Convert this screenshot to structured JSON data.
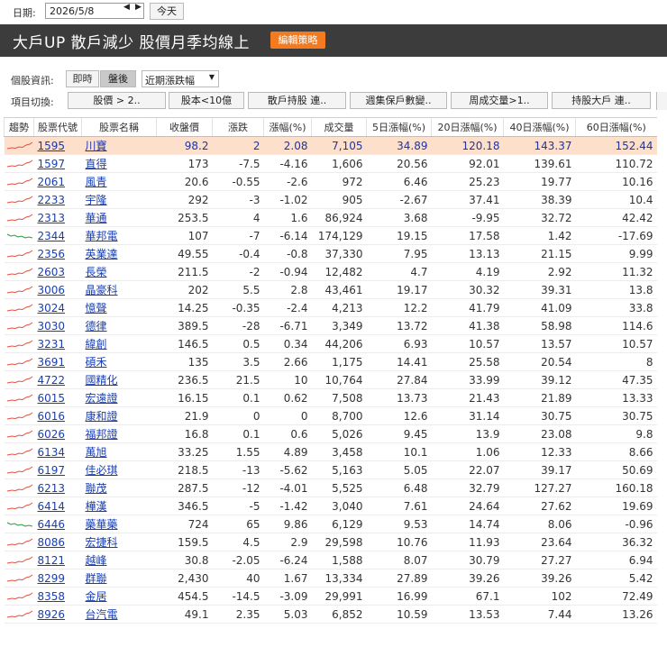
{
  "datebar": {
    "label": "日期:",
    "date": "2026/5/8",
    "prev": "◀",
    "next": "▶",
    "today": "今天"
  },
  "titlebar": {
    "title": "大戶UP 散戶減少 股價月季均線上",
    "edit": "編輯策略"
  },
  "info": {
    "label": "個股資訊:",
    "realtime": "即時",
    "after": "盤後",
    "select": "近期漲跌幅"
  },
  "switch": {
    "label": "項目切換:",
    "buttons": [
      "股價 > 2..",
      "股本<10億",
      "散戶持股 連..",
      "週集保戶數變..",
      "周成交量>1..",
      "持股大戶 連.."
    ]
  },
  "table": {
    "headers": [
      "趨勢",
      "股票代號",
      "股票名稱",
      "收盤價",
      "漲跌",
      "漲幅(%)",
      "成交量",
      "5日漲幅(%)",
      "20日漲幅(%)",
      "40日漲幅(%)",
      "60日漲幅(%)"
    ],
    "rows": [
      {
        "code": "1595",
        "name": "川寶",
        "close": "98.2",
        "chg": "2",
        "pct": "2.08",
        "vol": "7,105",
        "d5": "34.89",
        "d20": "120.18",
        "d40": "143.37",
        "d60": "152.44",
        "trend": "up"
      },
      {
        "code": "1597",
        "name": "直得",
        "close": "173",
        "chg": "-7.5",
        "pct": "-4.16",
        "vol": "1,606",
        "d5": "20.56",
        "d20": "92.01",
        "d40": "139.61",
        "d60": "110.72",
        "trend": "up"
      },
      {
        "code": "2061",
        "name": "風青",
        "close": "20.6",
        "chg": "-0.55",
        "pct": "-2.6",
        "vol": "972",
        "d5": "6.46",
        "d20": "25.23",
        "d40": "19.77",
        "d60": "10.16",
        "trend": "up"
      },
      {
        "code": "2233",
        "name": "宇隆",
        "close": "292",
        "chg": "-3",
        "pct": "-1.02",
        "vol": "905",
        "d5": "-2.67",
        "d20": "37.41",
        "d40": "38.39",
        "d60": "10.4",
        "trend": "up"
      },
      {
        "code": "2313",
        "name": "華通",
        "close": "253.5",
        "chg": "4",
        "pct": "1.6",
        "vol": "86,924",
        "d5": "3.68",
        "d20": "-9.95",
        "d40": "32.72",
        "d60": "42.42",
        "trend": "up"
      },
      {
        "code": "2344",
        "name": "華邦電",
        "close": "107",
        "chg": "-7",
        "pct": "-6.14",
        "vol": "174,129",
        "d5": "19.15",
        "d20": "17.58",
        "d40": "1.42",
        "d60": "-17.69",
        "trend": "down"
      },
      {
        "code": "2356",
        "name": "英業達",
        "close": "49.55",
        "chg": "-0.4",
        "pct": "-0.8",
        "vol": "37,330",
        "d5": "7.95",
        "d20": "13.13",
        "d40": "21.15",
        "d60": "9.99",
        "trend": "up"
      },
      {
        "code": "2603",
        "name": "長榮",
        "close": "211.5",
        "chg": "-2",
        "pct": "-0.94",
        "vol": "12,482",
        "d5": "4.7",
        "d20": "4.19",
        "d40": "2.92",
        "d60": "11.32",
        "trend": "up"
      },
      {
        "code": "3006",
        "name": "晶豪科",
        "close": "202",
        "chg": "5.5",
        "pct": "2.8",
        "vol": "43,461",
        "d5": "19.17",
        "d20": "30.32",
        "d40": "39.31",
        "d60": "13.8",
        "trend": "up"
      },
      {
        "code": "3024",
        "name": "憶聲",
        "close": "14.25",
        "chg": "-0.35",
        "pct": "-2.4",
        "vol": "4,213",
        "d5": "12.2",
        "d20": "41.79",
        "d40": "41.09",
        "d60": "33.8",
        "trend": "up"
      },
      {
        "code": "3030",
        "name": "德律",
        "close": "389.5",
        "chg": "-28",
        "pct": "-6.71",
        "vol": "3,349",
        "d5": "13.72",
        "d20": "41.38",
        "d40": "58.98",
        "d60": "114.6",
        "trend": "up"
      },
      {
        "code": "3231",
        "name": "緯創",
        "close": "146.5",
        "chg": "0.5",
        "pct": "0.34",
        "vol": "44,206",
        "d5": "6.93",
        "d20": "10.57",
        "d40": "13.57",
        "d60": "10.57",
        "trend": "up"
      },
      {
        "code": "3691",
        "name": "碩禾",
        "close": "135",
        "chg": "3.5",
        "pct": "2.66",
        "vol": "1,175",
        "d5": "14.41",
        "d20": "25.58",
        "d40": "20.54",
        "d60": "8",
        "trend": "up"
      },
      {
        "code": "4722",
        "name": "國精化",
        "close": "236.5",
        "chg": "21.5",
        "pct": "10",
        "vol": "10,764",
        "d5": "27.84",
        "d20": "33.99",
        "d40": "39.12",
        "d60": "47.35",
        "trend": "up"
      },
      {
        "code": "6015",
        "name": "宏遠證",
        "close": "16.15",
        "chg": "0.1",
        "pct": "0.62",
        "vol": "7,508",
        "d5": "13.73",
        "d20": "21.43",
        "d40": "21.89",
        "d60": "13.33",
        "trend": "up"
      },
      {
        "code": "6016",
        "name": "康和證",
        "close": "21.9",
        "chg": "0",
        "pct": "0",
        "vol": "8,700",
        "d5": "12.6",
        "d20": "31.14",
        "d40": "30.75",
        "d60": "30.75",
        "trend": "up"
      },
      {
        "code": "6026",
        "name": "福邦證",
        "close": "16.8",
        "chg": "0.1",
        "pct": "0.6",
        "vol": "5,026",
        "d5": "9.45",
        "d20": "13.9",
        "d40": "23.08",
        "d60": "9.8",
        "trend": "up"
      },
      {
        "code": "6134",
        "name": "萬旭",
        "close": "33.25",
        "chg": "1.55",
        "pct": "4.89",
        "vol": "3,458",
        "d5": "10.1",
        "d20": "1.06",
        "d40": "12.33",
        "d60": "8.66",
        "trend": "up"
      },
      {
        "code": "6197",
        "name": "佳必琪",
        "close": "218.5",
        "chg": "-13",
        "pct": "-5.62",
        "vol": "5,163",
        "d5": "5.05",
        "d20": "22.07",
        "d40": "39.17",
        "d60": "50.69",
        "trend": "up"
      },
      {
        "code": "6213",
        "name": "聯茂",
        "close": "287.5",
        "chg": "-12",
        "pct": "-4.01",
        "vol": "5,525",
        "d5": "6.48",
        "d20": "32.79",
        "d40": "127.27",
        "d60": "160.18",
        "trend": "up"
      },
      {
        "code": "6414",
        "name": "樺漢",
        "close": "346.5",
        "chg": "-5",
        "pct": "-1.42",
        "vol": "3,040",
        "d5": "7.61",
        "d20": "24.64",
        "d40": "27.62",
        "d60": "19.69",
        "trend": "up"
      },
      {
        "code": "6446",
        "name": "藥華藥",
        "close": "724",
        "chg": "65",
        "pct": "9.86",
        "vol": "6,129",
        "d5": "9.53",
        "d20": "14.74",
        "d40": "8.06",
        "d60": "-0.96",
        "trend": "down"
      },
      {
        "code": "8086",
        "name": "宏捷科",
        "close": "159.5",
        "chg": "4.5",
        "pct": "2.9",
        "vol": "29,598",
        "d5": "10.76",
        "d20": "11.93",
        "d40": "23.64",
        "d60": "36.32",
        "trend": "up"
      },
      {
        "code": "8121",
        "name": "越峰",
        "close": "30.8",
        "chg": "-2.05",
        "pct": "-6.24",
        "vol": "1,588",
        "d5": "8.07",
        "d20": "30.79",
        "d40": "27.27",
        "d60": "6.94",
        "trend": "up"
      },
      {
        "code": "8299",
        "name": "群聯",
        "close": "2,430",
        "chg": "40",
        "pct": "1.67",
        "vol": "13,334",
        "d5": "27.89",
        "d20": "39.26",
        "d40": "39.26",
        "d60": "5.42",
        "trend": "up"
      },
      {
        "code": "8358",
        "name": "金居",
        "close": "454.5",
        "chg": "-14.5",
        "pct": "-3.09",
        "vol": "29,991",
        "d5": "16.99",
        "d20": "67.1",
        "d40": "102",
        "d60": "72.49",
        "trend": "up"
      },
      {
        "code": "8926",
        "name": "台汽電",
        "close": "49.1",
        "chg": "2.35",
        "pct": "5.03",
        "vol": "6,852",
        "d5": "10.59",
        "d20": "13.53",
        "d40": "7.44",
        "d60": "13.26",
        "trend": "up"
      }
    ]
  },
  "colors": {
    "highlight": "#fde0cb",
    "link": "#1a3fb0",
    "accent": "#f47a20",
    "titlebar": "#3c3c3c",
    "spark_up": "#e05040",
    "spark_down": "#2e9a3e"
  }
}
